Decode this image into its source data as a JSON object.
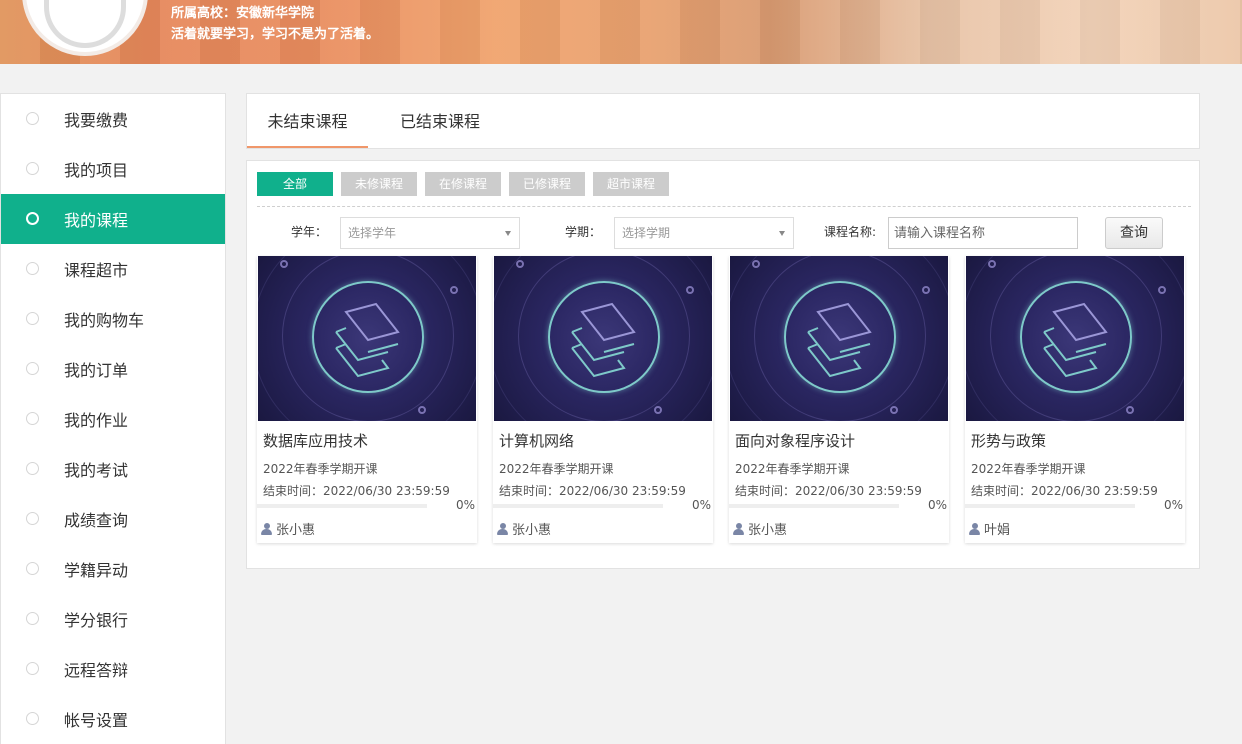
{
  "header": {
    "school_line": "所属高校：安徽新华学院",
    "motto": "活着就要学习，学习不是为了活着。"
  },
  "sidebar": {
    "items": [
      {
        "label": "我要缴费"
      },
      {
        "label": "我的项目"
      },
      {
        "label": "我的课程",
        "active": true
      },
      {
        "label": "课程超市"
      },
      {
        "label": "我的购物车"
      },
      {
        "label": "我的订单"
      },
      {
        "label": "我的作业"
      },
      {
        "label": "我的考试"
      },
      {
        "label": "成绩查询"
      },
      {
        "label": "学籍异动"
      },
      {
        "label": "学分银行"
      },
      {
        "label": "远程答辩"
      },
      {
        "label": "帐号设置"
      }
    ]
  },
  "tabs": {
    "unfinished": "未结束课程",
    "finished": "已结束课程"
  },
  "filters": {
    "all": "全部",
    "not_taken": "未修课程",
    "in_progress": "在修课程",
    "completed": "已修课程",
    "market": "超市课程"
  },
  "search": {
    "year_label": "学年：",
    "year_placeholder": "选择学年",
    "term_label": "学期：",
    "term_placeholder": "选择学期",
    "name_label": "课程名称:",
    "name_placeholder": "请输入课程名称",
    "query_button": "查询"
  },
  "courses": [
    {
      "title": "数据库应用技术",
      "term": "2022年春季学期开课",
      "end": "结束时间：2022/06/30 23:59:59",
      "progress_pct": "0%",
      "progress": 0,
      "teacher": "张小惠"
    },
    {
      "title": "计算机网络",
      "term": "2022年春季学期开课",
      "end": "结束时间：2022/06/30 23:59:59",
      "progress_pct": "0%",
      "progress": 0,
      "teacher": "张小惠"
    },
    {
      "title": "面向对象程序设计",
      "term": "2022年春季学期开课",
      "end": "结束时间：2022/06/30 23:59:59",
      "progress_pct": "0%",
      "progress": 0,
      "teacher": "张小惠"
    },
    {
      "title": "形势与政策",
      "term": "2022年春季学期开课",
      "end": "结束时间：2022/06/30 23:59:59",
      "progress_pct": "0%",
      "progress": 0,
      "teacher": "叶娟"
    }
  ],
  "colors": {
    "accent": "#10b08c",
    "tab_underline": "#f0976a"
  }
}
